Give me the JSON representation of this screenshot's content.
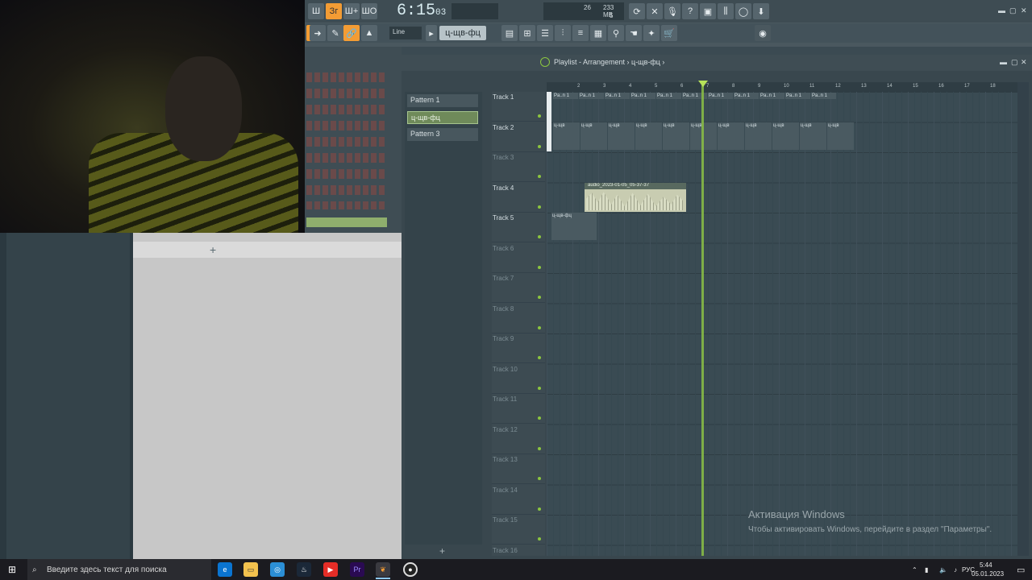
{
  "toolbar": {
    "time_main": "6:15",
    "time_sub": "03",
    "cpu_mem": "233 MB",
    "cpu_val": "26",
    "poly": "5",
    "snap": "Line",
    "pattern": "ц-щв-фц",
    "mode_icons": [
      "Ш",
      "Зг",
      "Ш+",
      "ШО"
    ]
  },
  "playlist": {
    "breadcrumb": "Playlist - Arrangement › ц-щв-фц ›",
    "patterns": [
      "Pattern 1",
      "ц-щв-фц",
      "Pattern 3"
    ],
    "ruler": [
      "2",
      "3",
      "4",
      "5",
      "6",
      "7",
      "8",
      "9",
      "10",
      "11",
      "12",
      "13",
      "14",
      "15",
      "16",
      "17",
      "18"
    ],
    "tracks": [
      "Track 1",
      "Track 2",
      "Track 3",
      "Track 4",
      "Track 5",
      "Track 6",
      "Track 7",
      "Track 8",
      "Track 9",
      "Track 10",
      "Track 11",
      "Track 12",
      "Track 13",
      "Track 14",
      "Track 15",
      "Track 16"
    ],
    "clip_pattern1": "Pa..n 1",
    "clip_pattern2": "ц-щв",
    "clip_pattern2_full": "ц-щв-фц",
    "audio_clip": "audio_2023-01-05_05-37-37"
  },
  "activation": {
    "title": "Активация Windows",
    "subtitle": "Чтобы активировать Windows, перейдите в раздел \"Параметры\"."
  },
  "taskbar": {
    "search_placeholder": "Введите здесь текст для поиска",
    "lang": "РУС",
    "time": "5:44",
    "date": "05.01.2023",
    "apps": [
      "edge",
      "explorer",
      "chrome",
      "steam",
      "youtube",
      "premiere",
      "fl-studio",
      "obs"
    ]
  }
}
